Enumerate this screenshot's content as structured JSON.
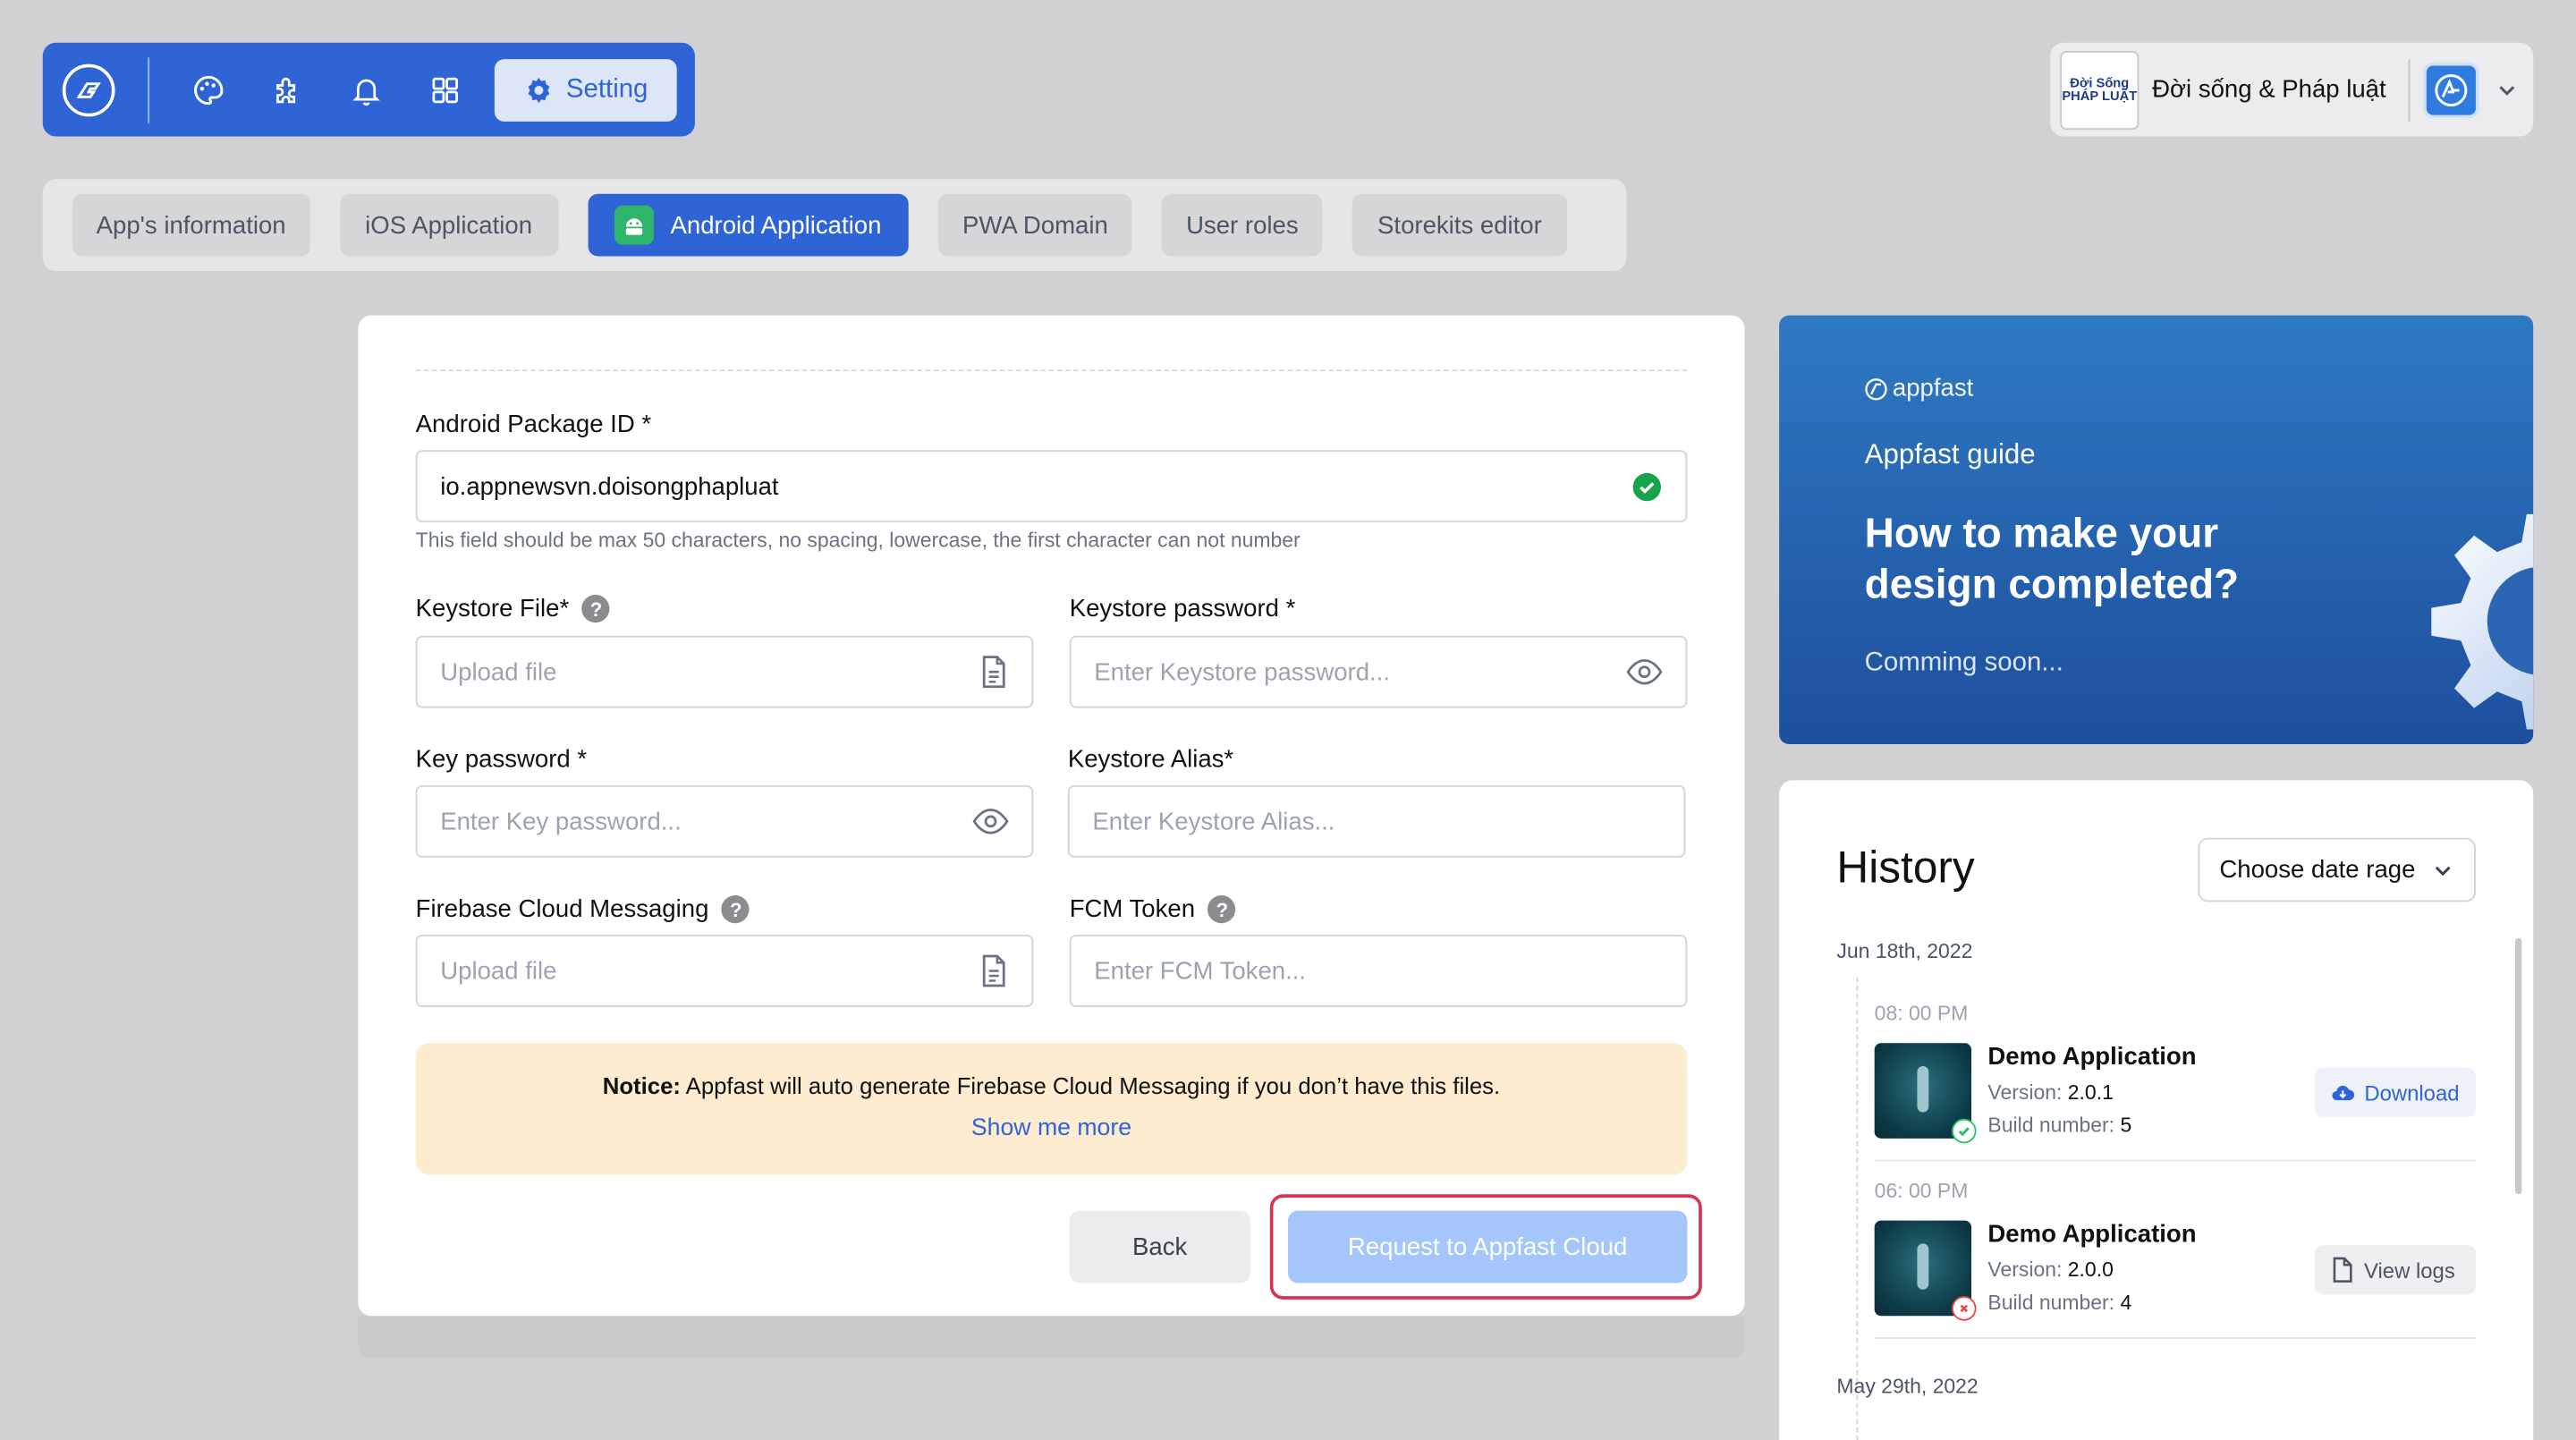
{
  "toolbar": {
    "setting_label": "Setting",
    "icons": [
      "app-logo-icon",
      "palette-icon",
      "puzzle-icon",
      "bell-icon",
      "grid-icon",
      "gear-icon"
    ]
  },
  "account": {
    "logo_text": "Đời Sống PHÁP LUẬT",
    "name": "Đời sống & Pháp luật"
  },
  "tabs": [
    {
      "label": "App's information",
      "active": false
    },
    {
      "label": "iOS Application",
      "active": false
    },
    {
      "label": "Android Application",
      "active": true
    },
    {
      "label": "PWA Domain",
      "active": false
    },
    {
      "label": "User roles",
      "active": false
    },
    {
      "label": "Storekits editor",
      "active": false
    }
  ],
  "form": {
    "package": {
      "label": "Android Package ID *",
      "value": "io.appnewsvn.doisongphapluat",
      "hint": "This field should be max 50 characters, no spacing, lowercase, the first character can not number"
    },
    "keystore_file": {
      "label": "Keystore File*",
      "placeholder": "Upload file"
    },
    "keystore_password": {
      "label": "Keystore password *",
      "placeholder": "Enter Keystore password..."
    },
    "key_password": {
      "label": "Key password *",
      "placeholder": "Enter Key password..."
    },
    "keystore_alias": {
      "label": "Keystore Alias*",
      "placeholder": "Enter Keystore Alias..."
    },
    "fcm_file": {
      "label": "Firebase Cloud Messaging",
      "placeholder": "Upload file"
    },
    "fcm_token": {
      "label": "FCM Token",
      "placeholder": "Enter FCM Token..."
    },
    "notice": {
      "title": "Notice:",
      "text": "Appfast will auto generate Firebase Cloud Messaging if you don’t have this files.",
      "link": "Show me more"
    },
    "back_label": "Back",
    "request_label": "Request to Appfast Cloud"
  },
  "guide": {
    "brand": "appfast",
    "subtitle": "Appfast guide",
    "title": "How to make your design completed?",
    "soon": "Comming soon..."
  },
  "history": {
    "title": "History",
    "date_select": "Choose date rage",
    "groups": [
      {
        "date": "Jun 18th, 2022",
        "builds": [
          {
            "time": "08: 00 PM",
            "name": "Demo Application",
            "version_label": "Version:",
            "version": "2.0.1",
            "build_label": "Build number:",
            "build": "5",
            "status": "success",
            "action": "Download"
          },
          {
            "time": "06: 00 PM",
            "name": "Demo Application",
            "version_label": "Version:",
            "version": "2.0.0",
            "build_label": "Build number:",
            "build": "4",
            "status": "failed",
            "action": "View logs"
          }
        ]
      },
      {
        "date": "May 29th, 2022",
        "builds": []
      }
    ]
  }
}
